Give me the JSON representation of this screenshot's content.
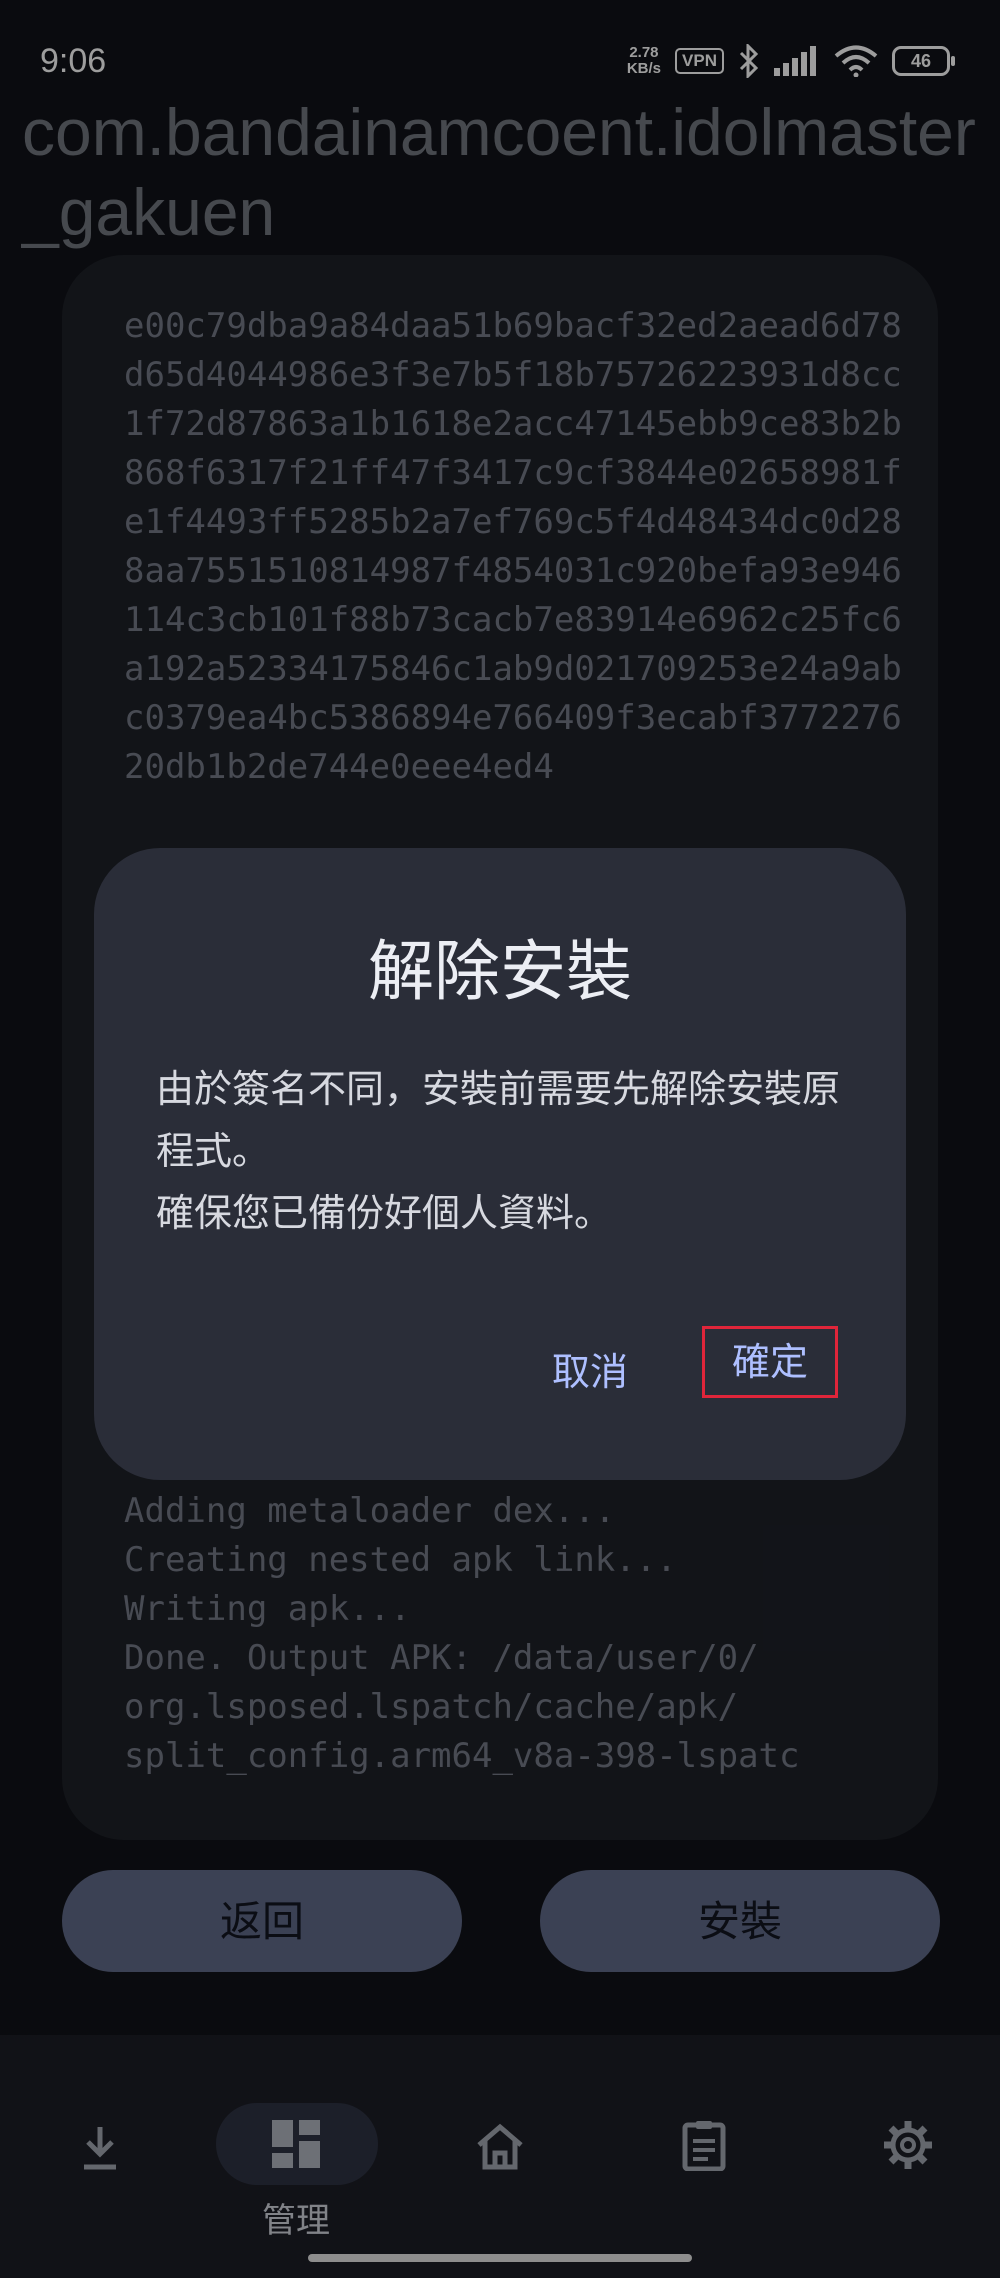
{
  "status_bar": {
    "time": "9:06",
    "net_speed_value": "2.78",
    "net_speed_unit": "KB/s",
    "vpn_label": "VPN",
    "battery_level": "46"
  },
  "app": {
    "package_name": "com.bandainamcoent.idolmaster_gakuen"
  },
  "log": {
    "top_text": "e00c79dba9a84daa51b69bacf32ed2aead6d78d65d4044986e3f3e7b5f18b75726223931d8cc1f72d87863a1b1618e2acc47145ebb9ce83b2b868f6317f21ff47f3417c9cf3844e02658981fe1f4493ff5285b2a7ef769c5f4d48434dc0d288aa7551510814987f4854031c920befa93e946114c3cb101f88b73cacb7e83914e6962c25fc6a192a52334175846c1ab9d021709253e24a9abc0379ea4bc5386894e766409f3ecabf377227620db1b2de744e0eee4ed4",
    "bottom_lines": [
      "Adding metaloader dex...",
      "Creating nested apk link...",
      "Writing apk...",
      "Done. Output APK: /data/user/0/",
      "org.lsposed.lspatch/cache/apk/",
      "split_config.arm64_v8a-398-lspatc"
    ]
  },
  "dialog": {
    "title": "解除安裝",
    "message": "由於簽名不同，安裝前需要先解除安裝原程式。\n確保您已備份好個人資料。",
    "cancel_label": "取消",
    "confirm_label": "確定",
    "highlight_color": "#e0253a"
  },
  "actions": {
    "back_label": "返回",
    "install_label": "安裝"
  },
  "nav": {
    "items": [
      {
        "icon": "download-icon",
        "label": ""
      },
      {
        "icon": "dashboard-icon",
        "label": "管理"
      },
      {
        "icon": "home-icon",
        "label": ""
      },
      {
        "icon": "clipboard-icon",
        "label": ""
      },
      {
        "icon": "gear-icon",
        "label": ""
      }
    ]
  },
  "colors": {
    "accent_text": "#aebfff",
    "button_fill": "#5b6481"
  }
}
